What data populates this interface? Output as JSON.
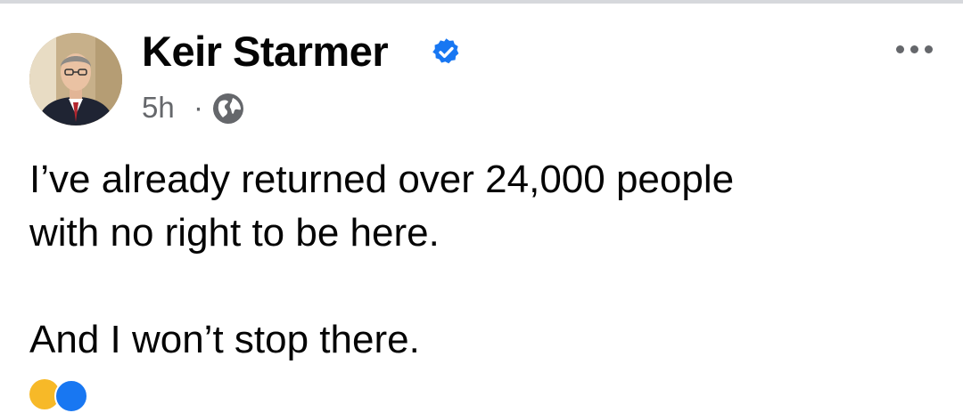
{
  "post": {
    "author_name": "Keir Starmer",
    "verified": true,
    "time": "5h",
    "separator": "·",
    "audience_icon": "globe-icon",
    "more_icon": "more-options-icon",
    "text_lines": [
      "I’ve already returned over 24,000 people",
      "with no right to be here."
    ],
    "text_paragraph_2": "And I won’t stop there."
  },
  "colors": {
    "text": "#050505",
    "secondary_text": "#65676b",
    "verified_badge": "#1877f2",
    "like_reaction": "#1877f2",
    "haha_reaction": "#f7b928"
  }
}
